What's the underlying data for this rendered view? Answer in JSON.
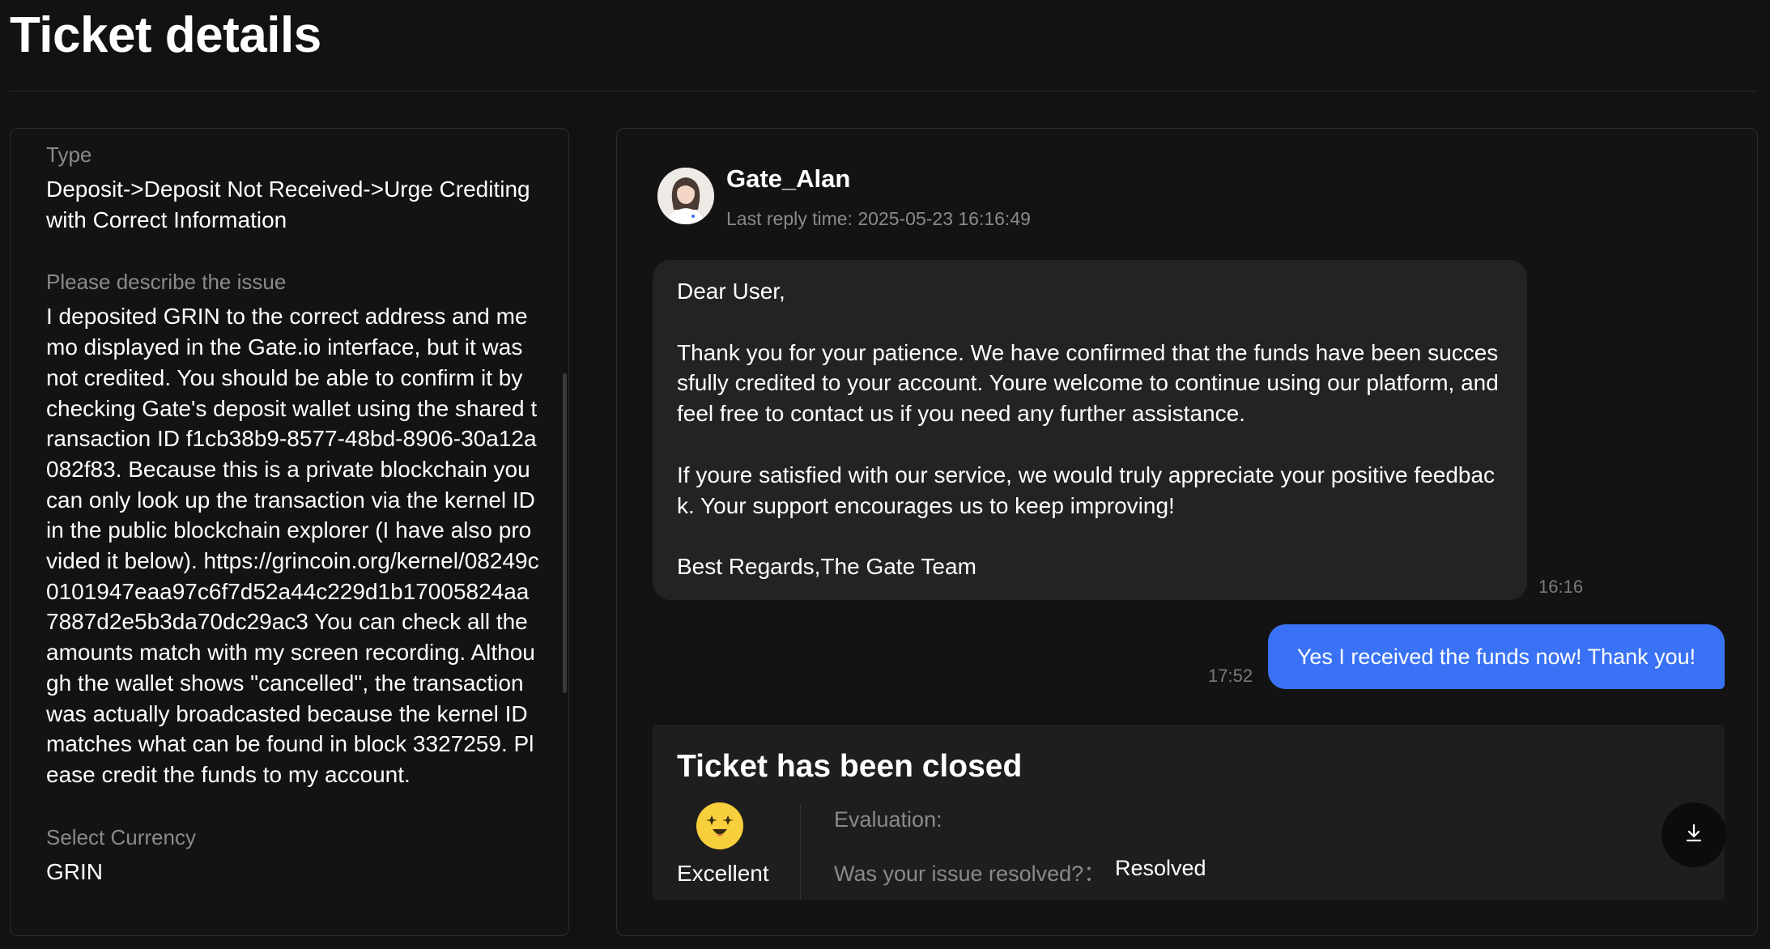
{
  "page": {
    "title": "Ticket details"
  },
  "details": {
    "type_label": "Type",
    "type_value": "Deposit->Deposit Not Received->Urge Crediting with Correct Information",
    "issue_label": "Please describe the issue",
    "issue_value": "I deposited GRIN to the correct address and memo displayed in the Gate.io interface, but it was not credited. You should be able to confirm it by checking Gate's deposit wallet using the shared transaction ID f1cb38b9-8577-48bd-8906-30a12a082f83. Because this is a private blockchain you can only look up the transaction via the kernel ID in the public blockchain explorer (I have also provided it below). https://grincoin.org/kernel/08249c0101947eaa97c6f7d52a44c229d1b17005824aa7887d2e5b3da70dc29ac3 You can check all the amounts match with my screen recording. Although the wallet shows \"cancelled\", the transaction was actually broadcasted because the kernel ID matches what can be found in block 3327259. Please credit the funds to my account.",
    "currency_label": "Select Currency",
    "currency_value": "GRIN"
  },
  "conversation": {
    "agent_name": "Gate_Alan",
    "last_reply": "Last reply time: 2025-05-23 16:16:49",
    "agent_message": "Dear User,\n\nThank you for your patience. We have confirmed that the funds have been successfully credited to your account. Youre welcome to continue using our platform, and feel free to contact us if you need any further assistance.\n\nIf youre satisfied with our service, we would truly appreciate your positive feedback. Your support encourages us to keep improving!\n\nBest Regards,The Gate Team",
    "agent_time": "16:16",
    "user_message": "Yes I received the funds now! Thank you!",
    "user_time": "17:52"
  },
  "closure": {
    "title": "Ticket has been closed",
    "rating_icon": "star-struck-face-icon",
    "rating_label": "Excellent",
    "evaluation_label": "Evaluation:",
    "resolved_question": "Was your issue resolved?：",
    "resolved_answer": "Resolved"
  },
  "colors": {
    "background": "#121212",
    "accent_blue": "#3a72f5",
    "bubble_gray": "#232323",
    "emoji_yellow": "#f7cf3d"
  }
}
